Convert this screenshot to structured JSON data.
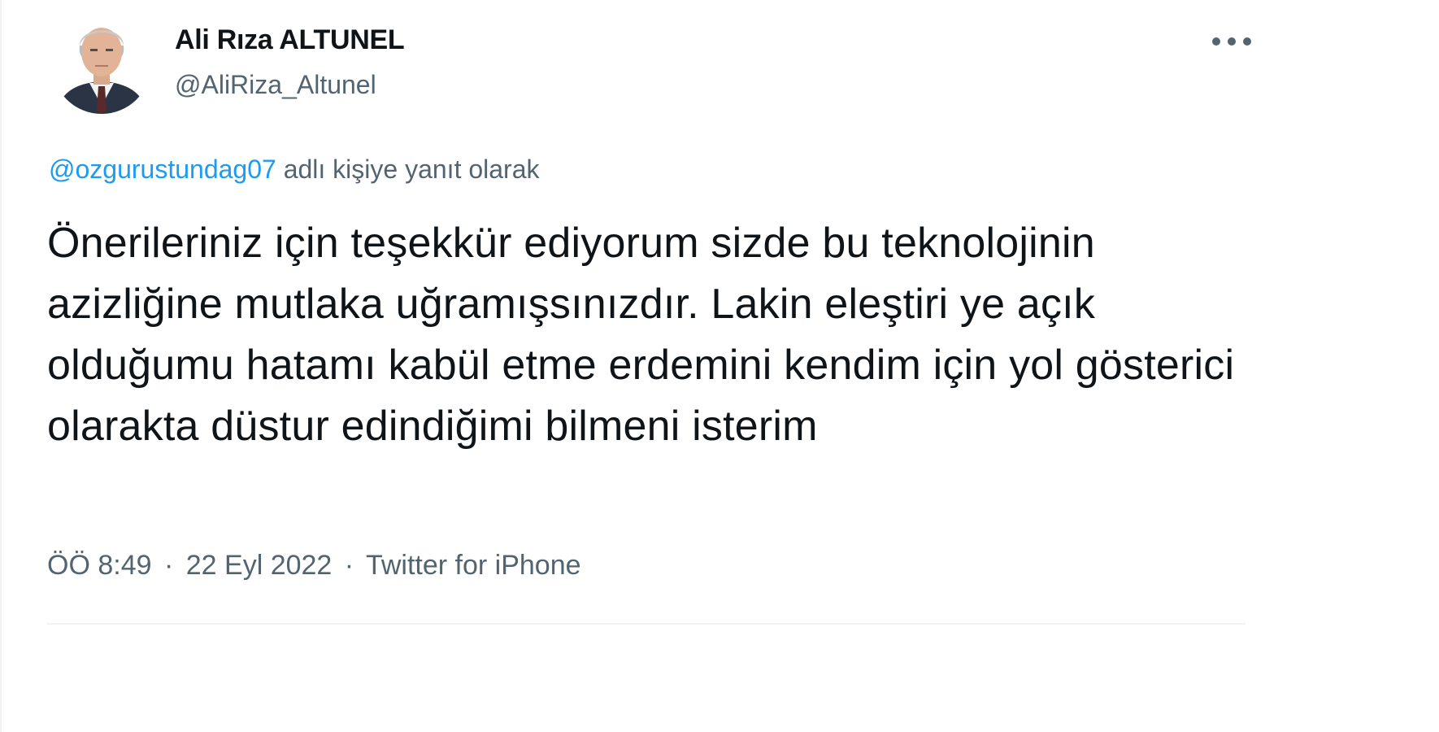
{
  "author": {
    "display_name": "Ali Rıza ALTUNEL",
    "handle": "@AliRiza_Altunel",
    "avatar_icon": "profile-photo"
  },
  "menu": {
    "more_icon": "more-horizontal-icon"
  },
  "reply_context": {
    "mention": "@ozgurustundag07",
    "suffix": " adlı kişiye yanıt olarak"
  },
  "tweet": {
    "text": "Önerileriniz için teşekkür ediyorum sizde bu teknolojinin azizliğine mutlaka uğramışsınızdır. Lakin eleştiri ye açık olduğumu hatamı kabül etme erdemini kendim için yol gösterici olarakta düstur edindiğimi bilmeni isterim"
  },
  "meta": {
    "time": "ÖÖ 8:49",
    "separator": "·",
    "date": "22 Eyl 2022",
    "source": "Twitter for iPhone"
  },
  "colors": {
    "text": "#0f1419",
    "secondary": "#536471",
    "link": "#1d9bf0",
    "divider": "#eff3f4"
  }
}
